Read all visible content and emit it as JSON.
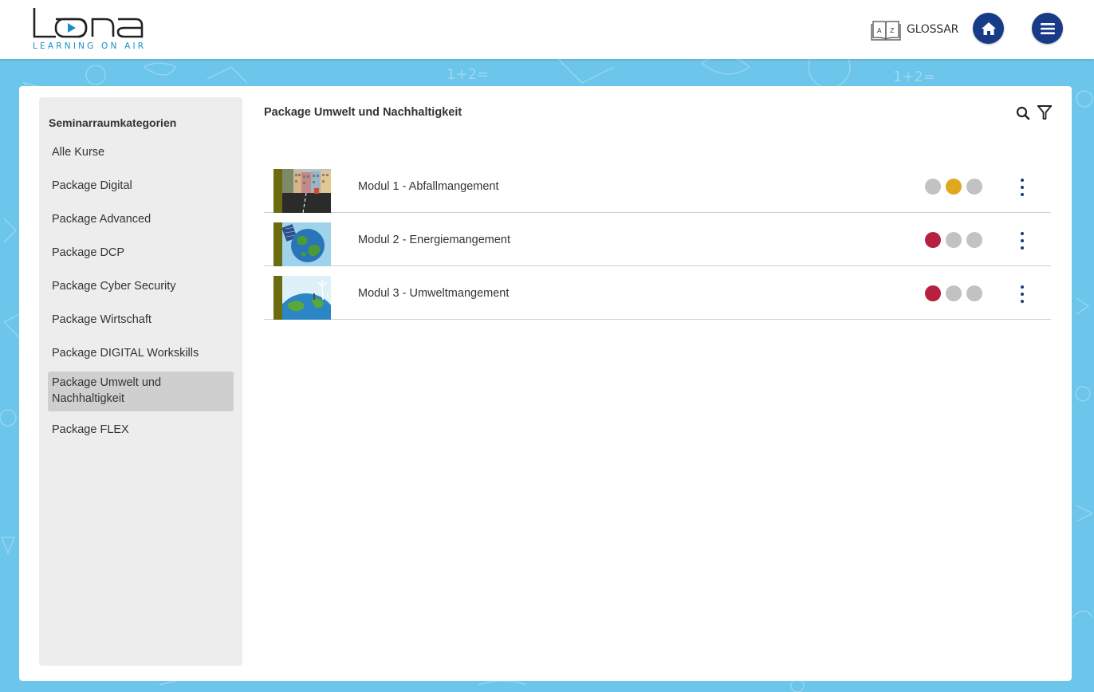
{
  "header": {
    "logo_word": "lona",
    "logo_tagline": "LEARNING ON AIR",
    "glossar_label": "GLOSSAR",
    "glossar_icon": "book-az-icon",
    "home_icon": "home-icon",
    "menu_icon": "hamburger-menu-icon"
  },
  "sidebar": {
    "title": "Seminarraumkategorien",
    "items": [
      {
        "label": "Alle Kurse"
      },
      {
        "label": "Package Digital"
      },
      {
        "label": "Package Advanced"
      },
      {
        "label": "Package DCP"
      },
      {
        "label": "Package Cyber Security"
      },
      {
        "label": "Package Wirtschaft"
      },
      {
        "label": "Package DIGITAL Workskills"
      },
      {
        "label": "Package Umwelt und Nachhaltigkeit",
        "active": true
      },
      {
        "label": "Package FLEX"
      }
    ]
  },
  "content": {
    "title": "Package Umwelt und Nachhaltigkeit",
    "modules": [
      {
        "label": "Modul 1 - Abfallmangement",
        "thumb": "street-buildings",
        "status_colors": [
          "#c2c2c2",
          "#e0a81e",
          "#c2c2c2"
        ]
      },
      {
        "label": "Modul 2 - Energiemangement",
        "thumb": "earth-solar",
        "status_colors": [
          "#b8203f",
          "#c2c2c2",
          "#c2c2c2"
        ]
      },
      {
        "label": "Modul 3 - Umweltmangement",
        "thumb": "earth-windmill",
        "status_colors": [
          "#b8203f",
          "#c2c2c2",
          "#c2c2c2"
        ]
      }
    ]
  },
  "colors": {
    "accent_navy": "#173b86",
    "background_blue": "#6cc5ea",
    "thumb_stripe": "#6b6b0f"
  }
}
